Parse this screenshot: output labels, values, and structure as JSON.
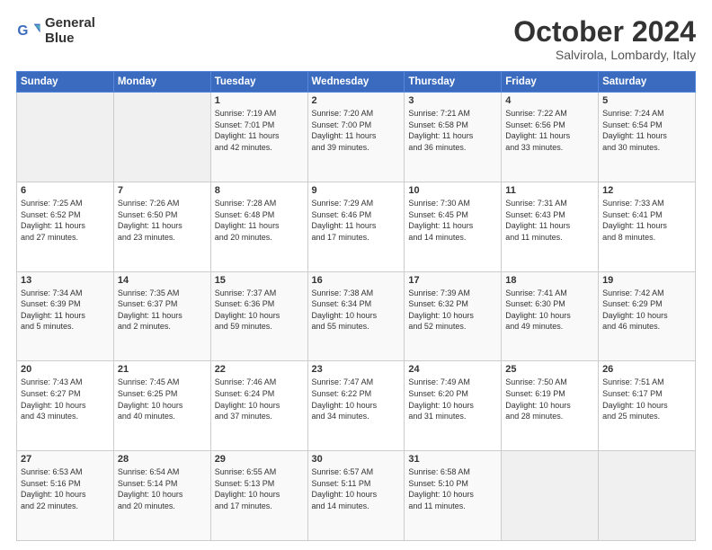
{
  "logo": {
    "line1": "General",
    "line2": "Blue"
  },
  "title": "October 2024",
  "location": "Salvirola, Lombardy, Italy",
  "header_days": [
    "Sunday",
    "Monday",
    "Tuesday",
    "Wednesday",
    "Thursday",
    "Friday",
    "Saturday"
  ],
  "weeks": [
    [
      {
        "day": "",
        "info": ""
      },
      {
        "day": "",
        "info": ""
      },
      {
        "day": "1",
        "info": "Sunrise: 7:19 AM\nSunset: 7:01 PM\nDaylight: 11 hours\nand 42 minutes."
      },
      {
        "day": "2",
        "info": "Sunrise: 7:20 AM\nSunset: 7:00 PM\nDaylight: 11 hours\nand 39 minutes."
      },
      {
        "day": "3",
        "info": "Sunrise: 7:21 AM\nSunset: 6:58 PM\nDaylight: 11 hours\nand 36 minutes."
      },
      {
        "day": "4",
        "info": "Sunrise: 7:22 AM\nSunset: 6:56 PM\nDaylight: 11 hours\nand 33 minutes."
      },
      {
        "day": "5",
        "info": "Sunrise: 7:24 AM\nSunset: 6:54 PM\nDaylight: 11 hours\nand 30 minutes."
      }
    ],
    [
      {
        "day": "6",
        "info": "Sunrise: 7:25 AM\nSunset: 6:52 PM\nDaylight: 11 hours\nand 27 minutes."
      },
      {
        "day": "7",
        "info": "Sunrise: 7:26 AM\nSunset: 6:50 PM\nDaylight: 11 hours\nand 23 minutes."
      },
      {
        "day": "8",
        "info": "Sunrise: 7:28 AM\nSunset: 6:48 PM\nDaylight: 11 hours\nand 20 minutes."
      },
      {
        "day": "9",
        "info": "Sunrise: 7:29 AM\nSunset: 6:46 PM\nDaylight: 11 hours\nand 17 minutes."
      },
      {
        "day": "10",
        "info": "Sunrise: 7:30 AM\nSunset: 6:45 PM\nDaylight: 11 hours\nand 14 minutes."
      },
      {
        "day": "11",
        "info": "Sunrise: 7:31 AM\nSunset: 6:43 PM\nDaylight: 11 hours\nand 11 minutes."
      },
      {
        "day": "12",
        "info": "Sunrise: 7:33 AM\nSunset: 6:41 PM\nDaylight: 11 hours\nand 8 minutes."
      }
    ],
    [
      {
        "day": "13",
        "info": "Sunrise: 7:34 AM\nSunset: 6:39 PM\nDaylight: 11 hours\nand 5 minutes."
      },
      {
        "day": "14",
        "info": "Sunrise: 7:35 AM\nSunset: 6:37 PM\nDaylight: 11 hours\nand 2 minutes."
      },
      {
        "day": "15",
        "info": "Sunrise: 7:37 AM\nSunset: 6:36 PM\nDaylight: 10 hours\nand 59 minutes."
      },
      {
        "day": "16",
        "info": "Sunrise: 7:38 AM\nSunset: 6:34 PM\nDaylight: 10 hours\nand 55 minutes."
      },
      {
        "day": "17",
        "info": "Sunrise: 7:39 AM\nSunset: 6:32 PM\nDaylight: 10 hours\nand 52 minutes."
      },
      {
        "day": "18",
        "info": "Sunrise: 7:41 AM\nSunset: 6:30 PM\nDaylight: 10 hours\nand 49 minutes."
      },
      {
        "day": "19",
        "info": "Sunrise: 7:42 AM\nSunset: 6:29 PM\nDaylight: 10 hours\nand 46 minutes."
      }
    ],
    [
      {
        "day": "20",
        "info": "Sunrise: 7:43 AM\nSunset: 6:27 PM\nDaylight: 10 hours\nand 43 minutes."
      },
      {
        "day": "21",
        "info": "Sunrise: 7:45 AM\nSunset: 6:25 PM\nDaylight: 10 hours\nand 40 minutes."
      },
      {
        "day": "22",
        "info": "Sunrise: 7:46 AM\nSunset: 6:24 PM\nDaylight: 10 hours\nand 37 minutes."
      },
      {
        "day": "23",
        "info": "Sunrise: 7:47 AM\nSunset: 6:22 PM\nDaylight: 10 hours\nand 34 minutes."
      },
      {
        "day": "24",
        "info": "Sunrise: 7:49 AM\nSunset: 6:20 PM\nDaylight: 10 hours\nand 31 minutes."
      },
      {
        "day": "25",
        "info": "Sunrise: 7:50 AM\nSunset: 6:19 PM\nDaylight: 10 hours\nand 28 minutes."
      },
      {
        "day": "26",
        "info": "Sunrise: 7:51 AM\nSunset: 6:17 PM\nDaylight: 10 hours\nand 25 minutes."
      }
    ],
    [
      {
        "day": "27",
        "info": "Sunrise: 6:53 AM\nSunset: 5:16 PM\nDaylight: 10 hours\nand 22 minutes."
      },
      {
        "day": "28",
        "info": "Sunrise: 6:54 AM\nSunset: 5:14 PM\nDaylight: 10 hours\nand 20 minutes."
      },
      {
        "day": "29",
        "info": "Sunrise: 6:55 AM\nSunset: 5:13 PM\nDaylight: 10 hours\nand 17 minutes."
      },
      {
        "day": "30",
        "info": "Sunrise: 6:57 AM\nSunset: 5:11 PM\nDaylight: 10 hours\nand 14 minutes."
      },
      {
        "day": "31",
        "info": "Sunrise: 6:58 AM\nSunset: 5:10 PM\nDaylight: 10 hours\nand 11 minutes."
      },
      {
        "day": "",
        "info": ""
      },
      {
        "day": "",
        "info": ""
      }
    ]
  ]
}
